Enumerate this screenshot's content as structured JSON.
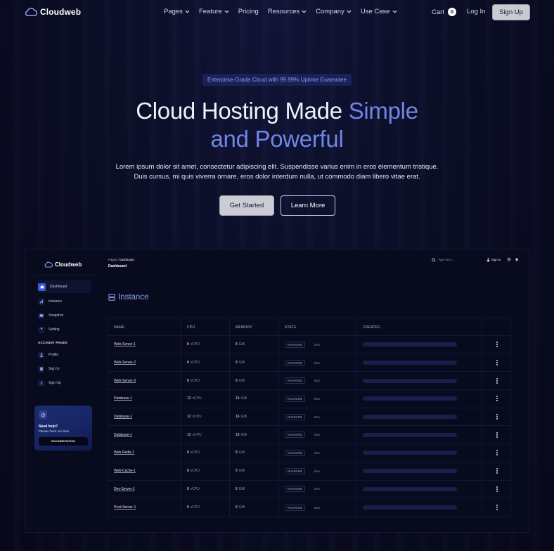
{
  "brand": {
    "name": "Cloudweb"
  },
  "nav": {
    "links": [
      {
        "label": "Pages",
        "dropdown": true
      },
      {
        "label": "Feature",
        "dropdown": true
      },
      {
        "label": "Pricing",
        "dropdown": false
      },
      {
        "label": "Resources",
        "dropdown": true
      },
      {
        "label": "Company",
        "dropdown": true
      },
      {
        "label": "Use Case",
        "dropdown": true
      }
    ],
    "cart_label": "Cart",
    "cart_count": "0",
    "login_label": "Log In",
    "signup_label": "Sign Up"
  },
  "hero": {
    "badge": "Enterprise-Grade Cloud with 99.99% Uptime Guarantee",
    "title_plain": "Cloud Hosting Made ",
    "title_accent_1": "Simple",
    "title_accent_2": "and Powerful",
    "description": "Lorem ipsum dolor sit amet, consectetur adipiscing elit. Suspendisse varius enim in eros elementum tristique. Duis cursus, mi quis viverra ornare, eros dolor interdum nulla, ut commodo diam libero vitae erat.",
    "primary_cta": "Get Started",
    "secondary_cta": "Learn More"
  },
  "dashboard": {
    "brand": "Cloudweb",
    "sidebar": {
      "items": [
        {
          "label": "Dashboard",
          "icon": "home-icon",
          "active": true
        },
        {
          "label": "Instance",
          "icon": "chart-icon",
          "active": false
        },
        {
          "label": "Snapshot",
          "icon": "snapshot-icon",
          "active": false
        },
        {
          "label": "Setting",
          "icon": "wrench-icon",
          "active": false
        }
      ],
      "section_label": "ACCOUNT PAGES",
      "account_items": [
        {
          "label": "Profile",
          "icon": "user-icon"
        },
        {
          "label": "Sign In",
          "icon": "document-icon"
        },
        {
          "label": "Sign Up",
          "icon": "rocket-icon"
        }
      ],
      "help": {
        "title": "Need help?",
        "subtitle": "Please check our docs",
        "button": "DOCUMENTATION"
      }
    },
    "topbar": {
      "breadcrumb_root": "Pages",
      "breadcrumb_sep": "/",
      "breadcrumb_current": "Dashboard",
      "page_title": "Dashboard",
      "search_placeholder": "Type here...",
      "signin_label": "Sign In"
    },
    "instance": {
      "title": "Instance",
      "columns": [
        "NAME",
        "CPU",
        "MEMORY",
        "STATE",
        "CREATED",
        ""
      ],
      "rows": [
        {
          "name": "Web-Server-1",
          "cpu": "8",
          "cpu_unit": "vCPU",
          "memory": "8",
          "memory_unit": "GiB",
          "state": "RUNNING",
          "age": "4mo"
        },
        {
          "name": "Web-Server-2",
          "cpu": "8",
          "cpu_unit": "vCPU",
          "memory": "8",
          "memory_unit": "GiB",
          "state": "RUNNING",
          "age": "4mo"
        },
        {
          "name": "Web-Server-3",
          "cpu": "8",
          "cpu_unit": "vCPU",
          "memory": "8",
          "memory_unit": "GiB",
          "state": "RUNNING",
          "age": "4mo"
        },
        {
          "name": "Database-1",
          "cpu": "12",
          "cpu_unit": "vCPU",
          "memory": "16",
          "memory_unit": "GiB",
          "state": "RUNNING",
          "age": "4mo"
        },
        {
          "name": "Database-1",
          "cpu": "12",
          "cpu_unit": "vCPU",
          "memory": "16",
          "memory_unit": "GiB",
          "state": "RUNNING",
          "age": "4mo"
        },
        {
          "name": "Database-1",
          "cpu": "12",
          "cpu_unit": "vCPU",
          "memory": "16",
          "memory_unit": "GiB",
          "state": "RUNNING",
          "age": "4mo"
        },
        {
          "name": "Web-Redis-1",
          "cpu": "8",
          "cpu_unit": "vCPU",
          "memory": "8",
          "memory_unit": "GiB",
          "state": "RUNNING",
          "age": "4mo"
        },
        {
          "name": "Web-Cache-1",
          "cpu": "8",
          "cpu_unit": "vCPU",
          "memory": "8",
          "memory_unit": "GiB",
          "state": "RUNNING",
          "age": "4mo"
        },
        {
          "name": "Dev-Server-1",
          "cpu": "8",
          "cpu_unit": "vCPU",
          "memory": "8",
          "memory_unit": "GiB",
          "state": "RUNNING",
          "age": "4mo"
        },
        {
          "name": "Prod-Server-1",
          "cpu": "8",
          "cpu_unit": "vCPU",
          "memory": "8",
          "memory_unit": "GiB",
          "state": "RUNNING",
          "age": "4mo"
        }
      ]
    }
  },
  "colors": {
    "background": "#0a0c22",
    "accent": "#6f86e6",
    "badge_bg": "#1b2057",
    "button_light": "#cbccd4",
    "sidebar_active": "#3e5ad6"
  }
}
